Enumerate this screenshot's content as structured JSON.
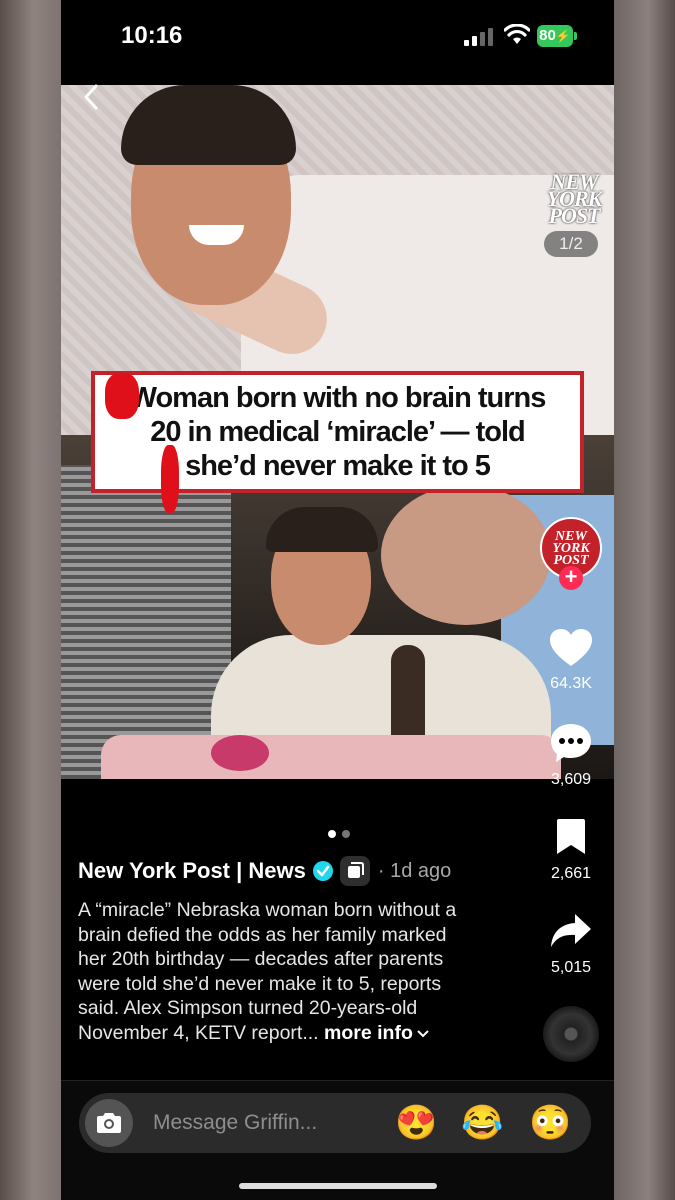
{
  "status_bar": {
    "time": "10:16",
    "battery": "80"
  },
  "post": {
    "page_indicator": "1/2",
    "logo_text": [
      "NEW",
      "YORK",
      "POST"
    ],
    "headline_lines": [
      "Woman born with no brain turns",
      "20 in medical ‘miracle’ — told",
      "she’d never make it to 5"
    ]
  },
  "rail": {
    "avatar_text": [
      "NEW",
      "YORK",
      "POST"
    ],
    "likes": "64.3K",
    "comments": "3,609",
    "saves": "2,661",
    "shares": "5,015"
  },
  "caption": {
    "author": "New York Post | News",
    "time_ago": "· 1d ago",
    "text": "A “miracle” Nebraska woman born without a brain defied the odds as her family marked her 20th birthday — decades after parents were told she’d never make it to 5, reports said. Alex Simpson turned 20-years-old November 4, KETV report...",
    "more_label": "more info",
    "carousel_dots": 2,
    "active_dot": 0
  },
  "message_bar": {
    "placeholder": "Message Griffin...",
    "emojis": [
      "😍",
      "😂",
      "😳"
    ]
  },
  "colors": {
    "brand_red": "#c3222b",
    "follow_pink": "#fe2c55",
    "verified": "#20d5ec",
    "battery_green": "#34c759"
  }
}
